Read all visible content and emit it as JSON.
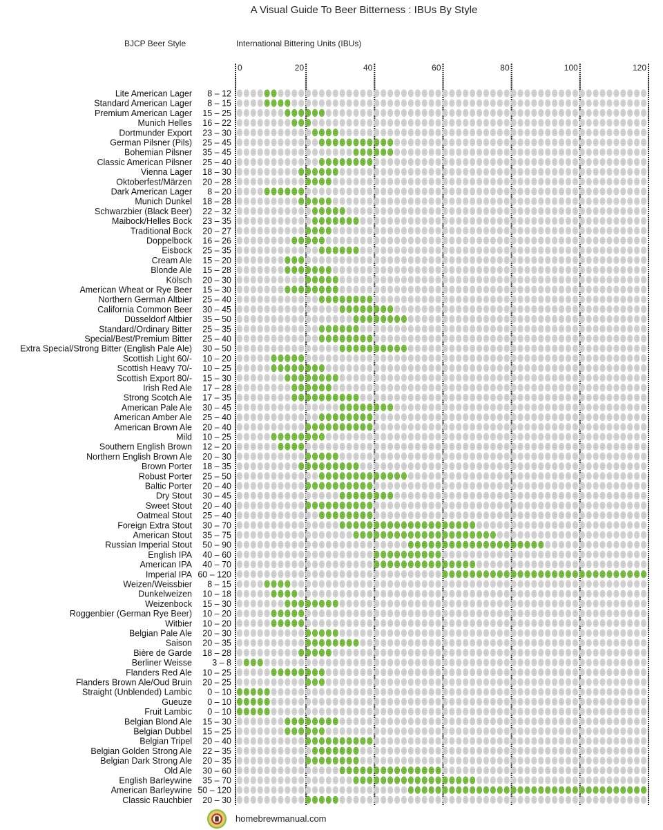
{
  "chart_data": {
    "type": "table",
    "title": "A Visual Guide To Beer Bitterness : IBUs By Style",
    "row_header": "BJCP Beer Style",
    "xlabel": "International Bittering Units (IBUs)",
    "xlim": [
      0,
      120
    ],
    "x_ticks": [
      0,
      20,
      40,
      60,
      80,
      100,
      120
    ],
    "hop_unit_ibu": 2,
    "colors": {
      "in_range": "#7cc243",
      "out_range": "#d4d4d4",
      "grid": "#222222"
    },
    "rows": [
      {
        "style": "Lite American Lager",
        "min": 8,
        "max": 12
      },
      {
        "style": "Standard American Lager",
        "min": 8,
        "max": 15
      },
      {
        "style": "Premium American Lager",
        "min": 15,
        "max": 25
      },
      {
        "style": "Munich Helles",
        "min": 16,
        "max": 22
      },
      {
        "style": "Dortmunder Export",
        "min": 23,
        "max": 30
      },
      {
        "style": "German Pilsner (Pils)",
        "min": 25,
        "max": 45
      },
      {
        "style": "Bohemian Pilsner",
        "min": 35,
        "max": 45
      },
      {
        "style": "Classic American Pilsner",
        "min": 25,
        "max": 40
      },
      {
        "style": "Vienna Lager",
        "min": 18,
        "max": 30
      },
      {
        "style": "Oktoberfest/Märzen",
        "min": 20,
        "max": 28
      },
      {
        "style": "Dark American Lager",
        "min": 8,
        "max": 20
      },
      {
        "style": "Munich Dunkel",
        "min": 18,
        "max": 28
      },
      {
        "style": "Schwarzbier (Black Beer)",
        "min": 22,
        "max": 32
      },
      {
        "style": "Maibock/Helles Bock",
        "min": 23,
        "max": 35
      },
      {
        "style": "Traditional Bock",
        "min": 20,
        "max": 27
      },
      {
        "style": "Doppelbock",
        "min": 16,
        "max": 26
      },
      {
        "style": "Eisbock",
        "min": 25,
        "max": 35
      },
      {
        "style": "Cream Ale",
        "min": 15,
        "max": 20
      },
      {
        "style": "Blonde Ale",
        "min": 15,
        "max": 28
      },
      {
        "style": "Kölsch",
        "min": 20,
        "max": 30
      },
      {
        "style": "American Wheat or Rye Beer",
        "min": 15,
        "max": 30
      },
      {
        "style": "Northern German Altbier",
        "min": 25,
        "max": 40
      },
      {
        "style": "California Common Beer",
        "min": 30,
        "max": 45
      },
      {
        "style": "Düsseldorf Altbier",
        "min": 35,
        "max": 50
      },
      {
        "style": "Standard/Ordinary Bitter",
        "min": 25,
        "max": 35
      },
      {
        "style": "Special/Best/Premium Bitter",
        "min": 25,
        "max": 40
      },
      {
        "style": "Extra Special/Strong Bitter (English Pale Ale)",
        "min": 30,
        "max": 50
      },
      {
        "style": "Scottish Light 60/-",
        "min": 10,
        "max": 20
      },
      {
        "style": "Scottish Heavy 70/-",
        "min": 10,
        "max": 25
      },
      {
        "style": "Scottish Export 80/-",
        "min": 15,
        "max": 30
      },
      {
        "style": "Irish Red Ale",
        "min": 17,
        "max": 28
      },
      {
        "style": "Strong Scotch Ale",
        "min": 17,
        "max": 35
      },
      {
        "style": "American Pale Ale",
        "min": 30,
        "max": 45
      },
      {
        "style": "American Amber Ale",
        "min": 25,
        "max": 40
      },
      {
        "style": "American Brown Ale",
        "min": 20,
        "max": 40
      },
      {
        "style": "Mild",
        "min": 10,
        "max": 25
      },
      {
        "style": "Southern English Brown",
        "min": 12,
        "max": 20
      },
      {
        "style": "Northern English Brown Ale",
        "min": 20,
        "max": 30
      },
      {
        "style": "Brown Porter",
        "min": 18,
        "max": 35
      },
      {
        "style": "Robust Porter",
        "min": 25,
        "max": 50
      },
      {
        "style": "Baltic Porter",
        "min": 20,
        "max": 40
      },
      {
        "style": "Dry Stout",
        "min": 30,
        "max": 45
      },
      {
        "style": "Sweet Stout",
        "min": 20,
        "max": 40
      },
      {
        "style": "Oatmeal Stout",
        "min": 25,
        "max": 40
      },
      {
        "style": "Foreign Extra Stout",
        "min": 30,
        "max": 70
      },
      {
        "style": "American Stout",
        "min": 35,
        "max": 75
      },
      {
        "style": "Russian Imperial Stout",
        "min": 50,
        "max": 90
      },
      {
        "style": "English IPA",
        "min": 40,
        "max": 60
      },
      {
        "style": "American IPA",
        "min": 40,
        "max": 70
      },
      {
        "style": "Imperial IPA",
        "min": 60,
        "max": 120
      },
      {
        "style": "Weizen/Weissbier",
        "min": 8,
        "max": 15
      },
      {
        "style": "Dunkelweizen",
        "min": 10,
        "max": 18
      },
      {
        "style": "Weizenbock",
        "min": 15,
        "max": 30
      },
      {
        "style": "Roggenbier (German Rye Beer)",
        "min": 10,
        "max": 20
      },
      {
        "style": "Witbier",
        "min": 10,
        "max": 20
      },
      {
        "style": "Belgian Pale Ale",
        "min": 20,
        "max": 30
      },
      {
        "style": "Saison",
        "min": 20,
        "max": 35
      },
      {
        "style": "Bière de Garde",
        "min": 18,
        "max": 28
      },
      {
        "style": "Berliner Weisse",
        "min": 3,
        "max": 8
      },
      {
        "style": "Flanders Red Ale",
        "min": 10,
        "max": 25
      },
      {
        "style": "Flanders Brown Ale/Oud Bruin",
        "min": 20,
        "max": 25
      },
      {
        "style": "Straight (Unblended) Lambic",
        "min": 0,
        "max": 10
      },
      {
        "style": "Gueuze",
        "min": 0,
        "max": 10
      },
      {
        "style": "Fruit Lambic",
        "min": 0,
        "max": 10
      },
      {
        "style": "Belgian Blond Ale",
        "min": 15,
        "max": 30
      },
      {
        "style": "Belgian Dubbel",
        "min": 15,
        "max": 25
      },
      {
        "style": "Belgian Tripel",
        "min": 20,
        "max": 40
      },
      {
        "style": "Belgian Golden Strong Ale",
        "min": 22,
        "max": 35
      },
      {
        "style": "Belgian Dark Strong Ale",
        "min": 20,
        "max": 35
      },
      {
        "style": "Old Ale",
        "min": 30,
        "max": 60
      },
      {
        "style": "English Barleywine",
        "min": 35,
        "max": 70
      },
      {
        "style": "American Barleywine",
        "min": 50,
        "max": 120
      },
      {
        "style": "Classic Rauchbier",
        "min": 20,
        "max": 30
      }
    ]
  },
  "header": {
    "title": "A Visual Guide To Beer Bitterness : IBUs By Style",
    "style_column": "BJCP Beer Style",
    "ibu_column": "International Bittering Units (IBUs)"
  },
  "footer": {
    "logo_icon": "homebrew-logo-icon",
    "site": "homebrewmanual.com"
  }
}
